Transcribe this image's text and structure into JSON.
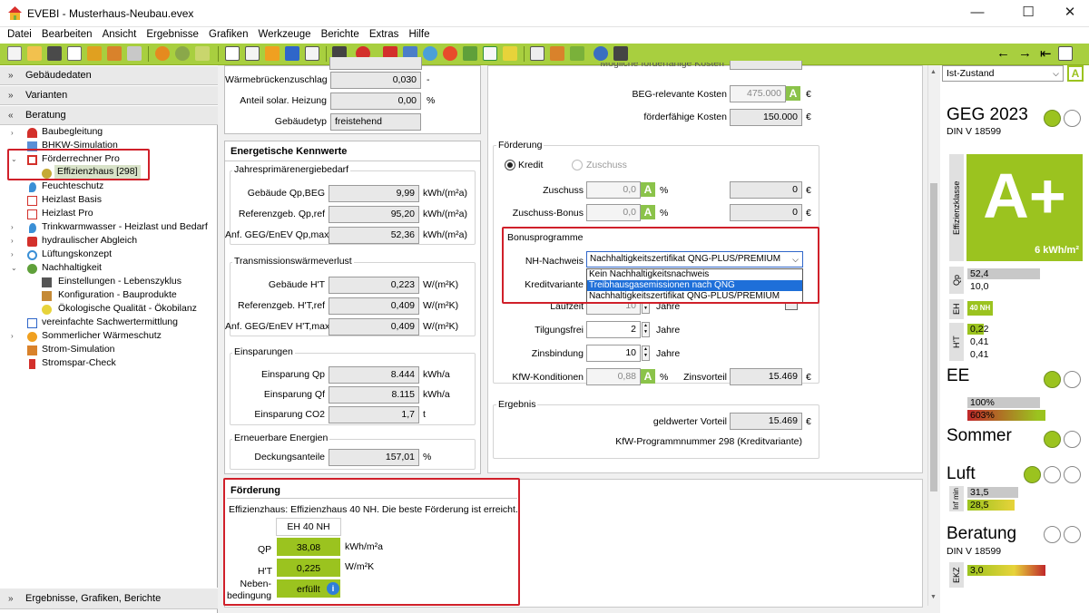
{
  "app": {
    "title": "EVEBI - Musterhaus-Neubau.evex",
    "min": "—",
    "max": "☐",
    "close": "✕"
  },
  "menu": [
    "Datei",
    "Bearbeiten",
    "Ansicht",
    "Ergebnisse",
    "Grafiken",
    "Werkzeuge",
    "Berichte",
    "Extras",
    "Hilfe"
  ],
  "nav": {
    "back": "←",
    "fwd": "→",
    "pin": "⇤"
  },
  "left": {
    "gebaeudedaten": "Gebäudedaten",
    "varianten": "Varianten",
    "beratung": "Beratung",
    "tree": {
      "baubegleitung": "Baubegleitung",
      "bhkw": "BHKW-Simulation",
      "foerderrechner": "Förderrechner Pro",
      "effizienzhaus": "Effizienzhaus [298]",
      "feuchteschutz": "Feuchteschutz",
      "heizlast_basis": "Heizlast Basis",
      "heizlast_pro": "Heizlast Pro",
      "trinkwarmwasser": "Trinkwarmwasser - Heizlast und Bedarf",
      "hydraulisch": "hydraulischer Abgleich",
      "lueftung": "Lüftungskonzept",
      "nachhaltigkeit": "Nachhaltigkeit",
      "einstellungen": "Einstellungen - Lebenszyklus",
      "konfiguration": "Konfiguration - Bauprodukte",
      "oekologisch": "Ökologische Qualität - Ökobilanz",
      "sachwert": "vereinfachte Sachwertermittlung",
      "sommer": "Sommerlicher Wärmeschutz",
      "strom": "Strom-Simulation",
      "stromspar": "Stromspar-Check"
    },
    "ergebnisse": "Ergebnisse, Grafiken, Berichte"
  },
  "top": {
    "waermebruecken_label": "Wärmebrückenzuschlag",
    "waermebruecken_val": "0,030",
    "waermebruecken_unit": "-",
    "solar_label": "Anteil solar. Heizung",
    "solar_val": "0,00",
    "solar_unit": "%",
    "gebaeudetyp_label": "Gebäudetyp",
    "gebaeudetyp_val": "freistehend"
  },
  "kennwerte": {
    "title": "Energetische Kennwerte",
    "jpeb_title": "Jahresprimärenergiebedarf",
    "qp_beg_label": "Gebäude Qp,BEG",
    "qp_beg_val": "9,99",
    "qp_beg_unit": "kWh/(m²a)",
    "qp_ref_label": "Referenzgeb. Qp,ref",
    "qp_ref_val": "95,20",
    "qp_ref_unit": "kWh/(m²a)",
    "qp_max_label": "Anf. GEG/EnEV Qp,max",
    "qp_max_val": "52,36",
    "qp_max_unit": "kWh/(m²a)",
    "ht_title": "Transmissionswärmeverlust",
    "ht_label": "Gebäude H'T",
    "ht_val": "0,223",
    "ht_unit": "W/(m²K)",
    "ht_ref_label": "Referenzgeb. H'T,ref",
    "ht_ref_val": "0,409",
    "ht_ref_unit": "W/(m²K)",
    "ht_max_label": "Anf. GEG/EnEV H'T,max",
    "ht_max_val": "0,409",
    "ht_max_unit": "W/(m²K)",
    "einsp_title": "Einsparungen",
    "einsp_qp_label": "Einsparung Qp",
    "einsp_qp_val": "8.444",
    "einsp_qp_unit": "kWh/a",
    "einsp_qf_label": "Einsparung Qf",
    "einsp_qf_val": "8.115",
    "einsp_qf_unit": "kWh/a",
    "einsp_co2_label": "Einsparung CO2",
    "einsp_co2_val": "1,7",
    "einsp_co2_unit": "t",
    "ee_title": "Erneuerbare Energien",
    "deck_label": "Deckungsanteile",
    "deck_val": "157,01",
    "deck_unit": "%"
  },
  "foerderung_box": {
    "title": "Förderung",
    "text": "Effizienzhaus: Effizienzhaus 40 NH.  Die beste Förderung ist erreicht.",
    "col_head": "EH 40 NH",
    "qp_label": "QP",
    "qp_val": "38,08",
    "qp_unit": "kWh/m²a",
    "ht_label": "H'T",
    "ht_val": "0,225",
    "ht_unit": "W/m²K",
    "neben_label": "Neben-\nbedingung",
    "neben_val": "erfüllt",
    "info": "i"
  },
  "kosten": {
    "hidden_label": "Mögliche förderfähige Kosten",
    "beg_label": "BEG-relevante Kosten",
    "beg_val": "475.000",
    "beg_unit": "€",
    "ff_label": "förderfähige Kosten",
    "ff_val": "150.000",
    "ff_unit": "€"
  },
  "foerderung": {
    "title": "Förderung",
    "kredit": "Kredit",
    "zuschuss_radio": "Zuschuss",
    "zuschuss_label": "Zuschuss",
    "zuschuss_val": "0,0",
    "zuschuss_unit": "%",
    "zuschuss_eur": "0",
    "eur": "€",
    "bonus_label": "Zuschuss-Bonus",
    "bonus_val": "0,0",
    "bonus_unit": "%",
    "bonus_eur": "0",
    "bonusprogramme": "Bonusprogramme",
    "nh_label": "NH-Nachweis",
    "nh_selected": "Nachhaltigkeitszertifikat QNG-PLUS/PREMIUM",
    "nh_options": [
      "Kein Nachhaltigkeitsnachweis",
      "Treibhausgasemissionen nach QNG",
      "Nachhaltigkeitszertifikat QNG-PLUS/PREMIUM"
    ],
    "kreditvariante_label": "Kreditvariante",
    "laufzeit_label": "Laufzeit",
    "laufzeit_val": "10",
    "jahre": "Jahre",
    "tilgung_label": "Tilgungsfrei",
    "tilgung_val": "2",
    "zinsbindung_label": "Zinsbindung",
    "zinsbindung_val": "10",
    "kfw_label": "KfW-Konditionen",
    "kfw_val": "0,88",
    "kfw_unit": "%",
    "zinsvorteil_label": "Zinsvorteil",
    "zinsvorteil_val": "15.469"
  },
  "ergebnis": {
    "title": "Ergebnis",
    "gv_label": "geldwerter Vorteil",
    "gv_val": "15.469",
    "gv_unit": "€",
    "kfw_text": "KfW-Programmnummer 298 (Kreditvariante)"
  },
  "right": {
    "zustand": "Ist-Zustand",
    "a_badge": "A",
    "geg": "GEG 2023",
    "din": "DIN V 18599",
    "klasse_vlabel": "Effizienzklasse",
    "klasse": "A+",
    "klasse_val": "6 kWh/m²",
    "qp_vlabel": "Qp",
    "qp1": "52,4",
    "qp2": "10,0",
    "eh_vlabel": "EH",
    "eh_badge": "40 NH",
    "ht_vlabel": "H'T",
    "ht1": "0,22",
    "ht2": "0,41",
    "ht3": "0,41",
    "ee": "EE",
    "ee_p1": "100%",
    "ee_p2": "603%",
    "sommer": "Sommer",
    "luft": "Luft",
    "luft_vlabel": "Inf min",
    "luft1": "31,5",
    "luft2": "28,5",
    "beratung": "Beratung",
    "beratung_din": "DIN V 18599",
    "ekz_vlabel": "EKZ",
    "ekz_val": "3,0",
    "colors": {
      "green": "#9bc31f",
      "bar_red": "#c0282a",
      "bar_grey": "#c8c8c8"
    }
  }
}
